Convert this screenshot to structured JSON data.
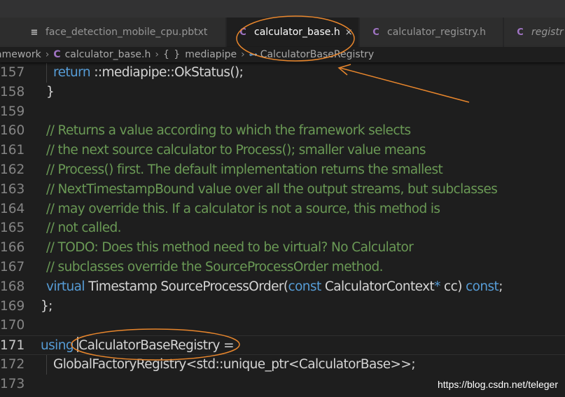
{
  "tabs": [
    {
      "label": "face_detection_mobile_cpu.pbtxt",
      "icon": "menu-lines-icon",
      "active": false,
      "italic": false
    },
    {
      "label": "calculator_base.h",
      "icon": "c-language-icon",
      "active": true,
      "italic": false,
      "close": "×"
    },
    {
      "label": "calculator_registry.h",
      "icon": "c-language-icon",
      "active": false,
      "italic": false
    },
    {
      "label": "registr",
      "icon": "c-language-icon",
      "active": false,
      "italic": true
    }
  ],
  "breadcrumb": {
    "items": [
      {
        "label": "amework"
      },
      {
        "label": "calculator_base.h",
        "icon": "C"
      },
      {
        "label": "mediapipe",
        "icon": "{ }"
      },
      {
        "label": "CalculatorBaseRegistry",
        "icon": "⊶"
      }
    ],
    "separator": "›"
  },
  "editor": {
    "current_line": "171",
    "lines": [
      {
        "num": "157",
        "tokens": [
          {
            "t": "return",
            "c": "keyword"
          },
          {
            "t": " ::mediapipe::OkStatus();",
            "c": "plain"
          }
        ]
      },
      {
        "num": "158",
        "tokens": [
          {
            "t": "}",
            "c": "plain"
          }
        ]
      },
      {
        "num": "159",
        "tokens": []
      },
      {
        "num": "160",
        "tokens": [
          {
            "t": "// Returns a value according to which the framework selects",
            "c": "comment"
          }
        ]
      },
      {
        "num": "161",
        "tokens": [
          {
            "t": "// the next source calculator to Process(); smaller value means",
            "c": "comment"
          }
        ]
      },
      {
        "num": "162",
        "tokens": [
          {
            "t": "// Process() first. The default implementation returns the smallest",
            "c": "comment"
          }
        ]
      },
      {
        "num": "163",
        "tokens": [
          {
            "t": "// NextTimestampBound value over all the output streams, but subclasses",
            "c": "comment"
          }
        ]
      },
      {
        "num": "164",
        "tokens": [
          {
            "t": "// may override this. If a calculator is not a source, this method is",
            "c": "comment"
          }
        ]
      },
      {
        "num": "165",
        "tokens": [
          {
            "t": "// not called.",
            "c": "comment"
          }
        ]
      },
      {
        "num": "166",
        "tokens": [
          {
            "t": "// TODO: Does this method need to be virtual? No Calculator",
            "c": "comment"
          }
        ]
      },
      {
        "num": "167",
        "tokens": [
          {
            "t": "// subclasses override the SourceProcessOrder method.",
            "c": "comment"
          }
        ]
      },
      {
        "num": "168",
        "tokens": [
          {
            "t": "virtual",
            "c": "keyword"
          },
          {
            "t": " Timestamp SourceProcessOrder(",
            "c": "plain"
          },
          {
            "t": "const",
            "c": "keyword"
          },
          {
            "t": " CalculatorContext",
            "c": "plain"
          },
          {
            "t": "*",
            "c": "ptr"
          },
          {
            "t": " cc) ",
            "c": "plain"
          },
          {
            "t": "const",
            "c": "keyword"
          },
          {
            "t": ";",
            "c": "plain"
          }
        ]
      },
      {
        "num": "169",
        "tokens": [
          {
            "t": "};",
            "c": "plain"
          }
        ]
      },
      {
        "num": "170",
        "tokens": []
      },
      {
        "num": "171",
        "tokens": [
          {
            "t": "using",
            "c": "keyword"
          },
          {
            "t": " ",
            "c": "plain"
          },
          {
            "t": "",
            "c": "cursor"
          },
          {
            "t": "CalculatorBaseRegistry =",
            "c": "plain"
          }
        ]
      },
      {
        "num": "172",
        "tokens": [
          {
            "t": "GlobalFactoryRegistry<std::unique_ptr<CalculatorBase>>;",
            "c": "plain"
          }
        ]
      },
      {
        "num": "173",
        "tokens": []
      }
    ]
  },
  "watermark": "https://blog.csdn.net/teleger",
  "colors": {
    "annotation": "#e8862c",
    "keyword": "#569cd6",
    "comment": "#6a9955",
    "text": "#d4d4d4",
    "background": "#1e1e1e",
    "c_icon": "#a074c4"
  }
}
